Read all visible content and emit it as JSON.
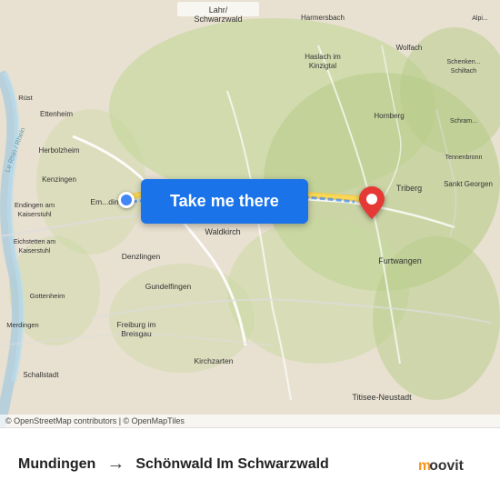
{
  "map": {
    "attribution": "© OpenStreetMap contributors | © OpenMapTiles"
  },
  "button": {
    "label": "Take me there"
  },
  "route": {
    "from": "Mundingen",
    "to": "Schönwald Im Schwarzwald",
    "arrow": "→"
  },
  "logo": {
    "brand": "moovit"
  },
  "markers": {
    "origin_color": "#4285f4",
    "dest_color": "#e53935"
  }
}
